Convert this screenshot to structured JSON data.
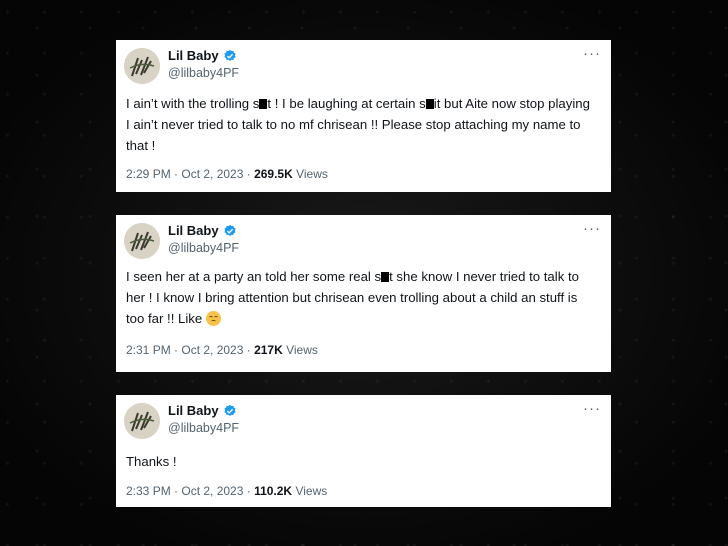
{
  "tweets": [
    {
      "author": "Lil Baby",
      "handle": "@lilbaby4PF",
      "text_parts": [
        "I ain’t with the trolling s",
        "t  ! I be laughing at certain s",
        "it but Aite now stop playing I ain’t never tried to talk to no mf chrisean !! Please stop attaching my name to that !"
      ],
      "time": "2:29 PM · Oct 2, 2023 · ",
      "views_count": "269.5K",
      "views_label": " Views"
    },
    {
      "author": "Lil Baby",
      "handle": "@lilbaby4PF",
      "text_parts": [
        "I seen her at a party an told her some real s",
        "t she know I never tried to talk to her ! I know I bring attention but chrisean even trolling about a child an stuff is too far !! Like "
      ],
      "emoji": "unamused-face-emoji",
      "time": "2:31 PM · Oct 2, 2023 · ",
      "views_count": "217K",
      "views_label": " Views"
    },
    {
      "author": "Lil Baby",
      "handle": "@lilbaby4PF",
      "text": "Thanks !",
      "time": "2:33 PM · Oct 2, 2023 · ",
      "views_count": "110.2K",
      "views_label": " Views"
    }
  ],
  "more_label": "···",
  "icons": {
    "verified": "verified-badge-icon",
    "more": "more-options-icon"
  },
  "colors": {
    "verified": "#1d9bf0",
    "secondary_text": "#536471",
    "primary_text": "#0f1419"
  }
}
